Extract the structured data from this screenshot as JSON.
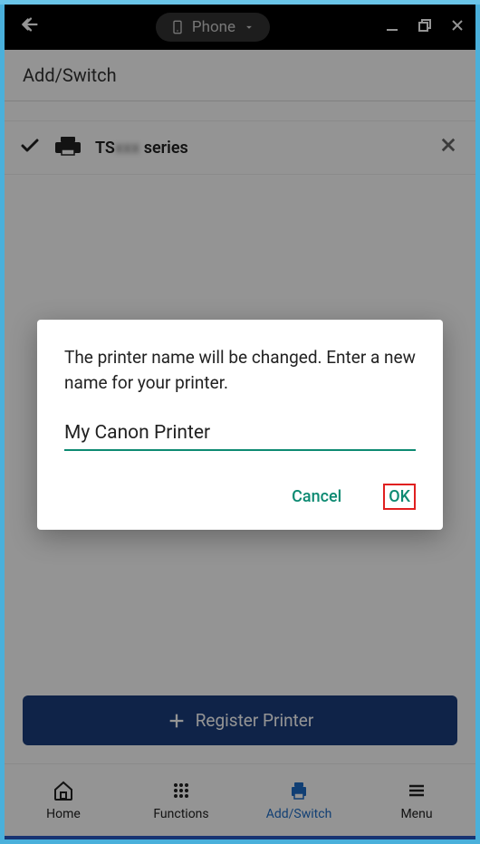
{
  "topbar": {
    "device_label": "Phone"
  },
  "header": {
    "title": "Add/Switch"
  },
  "printer_list": [
    {
      "name_prefix": "TS",
      "name_blur": "xxx",
      "name_suffix": " series"
    }
  ],
  "register_button": "Register Printer",
  "bottom_nav": {
    "home": "Home",
    "functions": "Functions",
    "add_switch": "Add/Switch",
    "menu": "Menu"
  },
  "dialog": {
    "message": "The printer name will be changed. Enter a new name for your printer.",
    "input_value": "My Canon Printer",
    "cancel": "Cancel",
    "ok": "OK"
  }
}
